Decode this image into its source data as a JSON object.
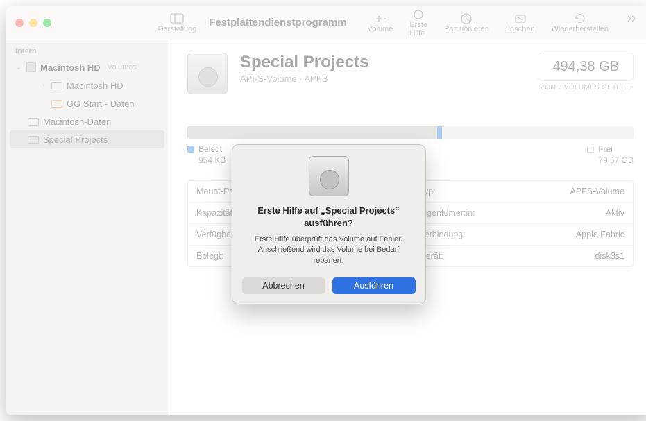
{
  "app_title": "Festplattendienstprogramm",
  "toolbar": {
    "view": "Darstellung",
    "volume": "Volume",
    "first_aid": "Erste Hilfe",
    "partition": "Partitionieren",
    "erase": "Löschen",
    "restore": "Wiederherstellen"
  },
  "sidebar": {
    "section": "Intern",
    "items": [
      {
        "label": "Macintosh HD",
        "sub": "Volumes"
      },
      {
        "label": "Macintosh HD"
      },
      {
        "label": "GG Start - Daten"
      },
      {
        "label": "Macintosh-Daten"
      },
      {
        "label": "Special Projects"
      }
    ]
  },
  "volume": {
    "name": "Special Projects",
    "subtitle": "APFS-Volume · APFS",
    "size": "494,38 GB",
    "size_caption": "VON 7 VOLUMES GETEILT"
  },
  "usage": {
    "used_label": "Belegt",
    "used_value": "954 KB",
    "free_label": "Frei",
    "free_value": "79,57 GB"
  },
  "info_rows": [
    {
      "k1": "Mount-Point:",
      "v1": "",
      "k2": "Typ:",
      "v2": "APFS-Volume"
    },
    {
      "k1": "Kapazität:",
      "v1": "",
      "k2": "Eigentümer:in:",
      "v2": "Aktiv"
    },
    {
      "k1": "Verfügbar:",
      "v1": "",
      "k2": "Verbindung:",
      "v2": "Apple Fabric"
    },
    {
      "k1": "Belegt:",
      "v1": "",
      "k2": "Gerät:",
      "v2": "disk3s1"
    }
  ],
  "dialog": {
    "title": "Erste Hilfe auf „Special Projects“ ausführen?",
    "body": "Erste Hilfe überprüft das Volume auf Fehler. Anschließend wird das Volume bei Bedarf repariert.",
    "cancel": "Abbrechen",
    "confirm": "Ausführen"
  }
}
